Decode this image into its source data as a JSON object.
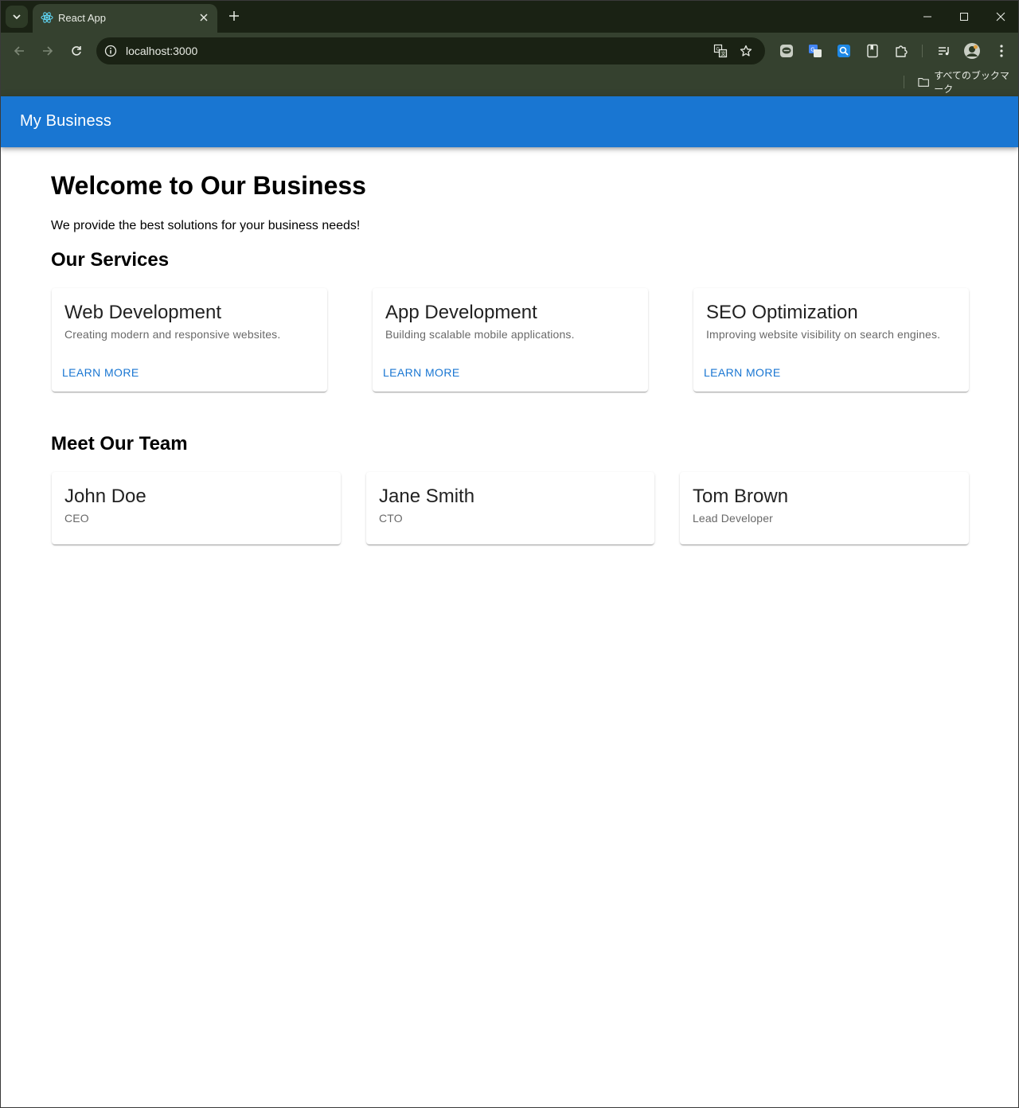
{
  "browser": {
    "tab": {
      "title": "React App"
    },
    "omnibox": {
      "url": "localhost:3000"
    },
    "bookmarks": {
      "all_bookmarks_label": "すべてのブックマーク"
    }
  },
  "app": {
    "title": "My Business"
  },
  "hero": {
    "heading": "Welcome to Our Business",
    "subtitle": "We provide the best solutions for your business needs!"
  },
  "services": {
    "heading": "Our Services",
    "items": [
      {
        "title": "Web Development",
        "description": "Creating modern and responsive websites.",
        "action": "LEARN MORE"
      },
      {
        "title": "App Development",
        "description": "Building scalable mobile applications.",
        "action": "LEARN MORE"
      },
      {
        "title": "SEO Optimization",
        "description": "Improving website visibility on search engines.",
        "action": "LEARN MORE"
      }
    ]
  },
  "team": {
    "heading": "Meet Our Team",
    "members": [
      {
        "name": "John Doe",
        "role": "CEO"
      },
      {
        "name": "Jane Smith",
        "role": "CTO"
      },
      {
        "name": "Tom Brown",
        "role": "Lead Developer"
      }
    ]
  },
  "colors": {
    "appbar": "#1976d2",
    "primary": "#1976d2",
    "chrome_dark": "#1a2214",
    "chrome": "#35412f"
  }
}
